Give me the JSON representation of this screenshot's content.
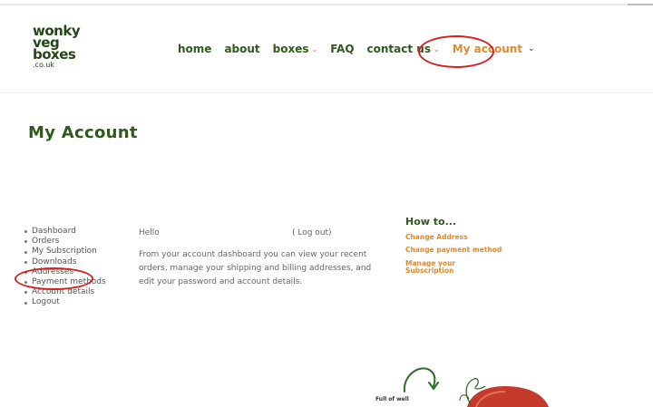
{
  "brand": {
    "logo_line1": "wonky",
    "logo_line2": "veg",
    "logo_line3": "boxes",
    "logo_line4": ".co.uk"
  },
  "nav": {
    "items": [
      {
        "label": "home",
        "has_caret": false
      },
      {
        "label": "about",
        "has_caret": false
      },
      {
        "label": "boxes",
        "has_caret": true
      },
      {
        "label": "FAQ",
        "has_caret": false
      },
      {
        "label": "contact us",
        "has_caret": true
      },
      {
        "label": "My account",
        "has_caret": true,
        "active": true
      }
    ],
    "caret_glyph": "⌄",
    "active_color": "#e08a2e",
    "primary_color": "#2f5a1f"
  },
  "page": {
    "title": "My Account"
  },
  "account_nav": {
    "items": [
      "Dashboard",
      "Orders",
      "My Subscription",
      "Downloads",
      "Addresses",
      "Payment methods",
      "Account details",
      "Logout"
    ]
  },
  "dashboard": {
    "hello": "Hello",
    "logout_text": "( Log out)",
    "description": "From your account dashboard you can view your recent orders, manage your shipping and billing addresses, and edit your password and account details."
  },
  "howto": {
    "title": "How to...",
    "links": [
      "Change Address",
      "Change payment method",
      "Manage your Subscription"
    ]
  },
  "footer": {
    "teaser": "Full of well"
  },
  "annotations": {
    "highlight_color": "#d42121"
  }
}
